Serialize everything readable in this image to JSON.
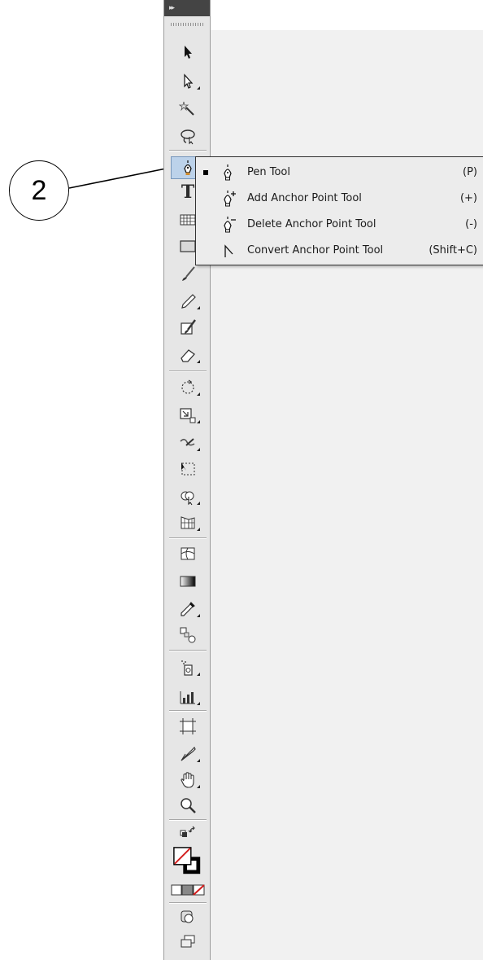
{
  "callout": {
    "number": "2"
  },
  "toolbar": {
    "header_glyph": "▸▸",
    "tools": [
      {
        "name": "selection-tool-icon"
      },
      {
        "name": "direct-selection-tool-icon"
      },
      {
        "name": "magic-wand-tool-icon"
      },
      {
        "name": "lasso-tool-icon"
      },
      {
        "name": "pen-tool-icon",
        "active": true
      },
      {
        "name": "type-tool-icon",
        "glyph": "T"
      },
      {
        "name": "line-segment-tool-icon"
      },
      {
        "name": "rectangle-tool-icon"
      },
      {
        "name": "paintbrush-tool-icon"
      },
      {
        "name": "pencil-tool-icon"
      },
      {
        "name": "blob-brush-tool-icon"
      },
      {
        "name": "eraser-tool-icon"
      },
      {
        "name": "rotate-tool-icon"
      },
      {
        "name": "scale-tool-icon"
      },
      {
        "name": "warp-tool-icon"
      },
      {
        "name": "free-transform-tool-icon"
      },
      {
        "name": "shape-builder-tool-icon"
      },
      {
        "name": "perspective-grid-tool-icon"
      },
      {
        "name": "mesh-tool-icon"
      },
      {
        "name": "gradient-tool-icon"
      },
      {
        "name": "eyedropper-tool-icon"
      },
      {
        "name": "blend-tool-icon"
      },
      {
        "name": "symbol-sprayer-tool-icon"
      },
      {
        "name": "column-graph-tool-icon"
      },
      {
        "name": "artboard-tool-icon"
      },
      {
        "name": "slice-tool-icon"
      },
      {
        "name": "hand-tool-icon"
      },
      {
        "name": "zoom-tool-icon"
      }
    ]
  },
  "flyout": {
    "items": [
      {
        "label": "Pen Tool",
        "shortcut": "(P)",
        "selected": true,
        "icon": "pen-icon"
      },
      {
        "label": "Add Anchor Point Tool",
        "shortcut": "(+)",
        "selected": false,
        "icon": "add-anchor-point-icon"
      },
      {
        "label": "Delete Anchor Point Tool",
        "shortcut": "(-)",
        "selected": false,
        "icon": "delete-anchor-point-icon"
      },
      {
        "label": "Convert Anchor Point Tool",
        "shortcut": "(Shift+C)",
        "selected": false,
        "icon": "convert-anchor-point-icon"
      }
    ]
  },
  "colors": {
    "toolbar_bg": "#e6e6e6",
    "active_tool_bg": "#bcd2ea",
    "menu_bg": "#ececec"
  }
}
